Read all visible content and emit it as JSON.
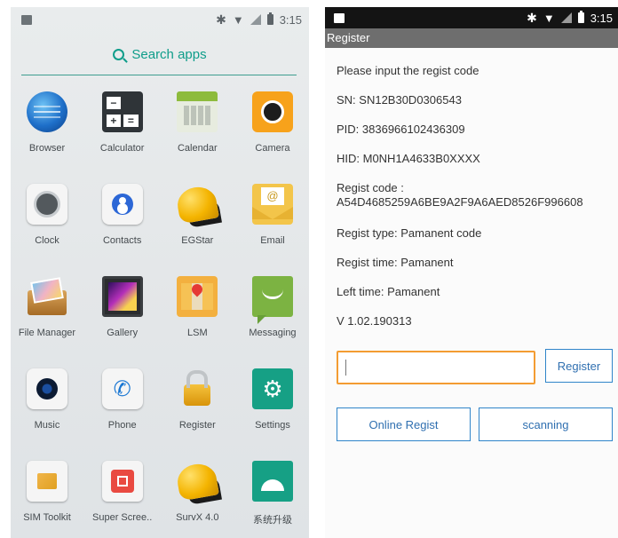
{
  "launcher": {
    "status_time": "3:15",
    "search_label": "Search apps",
    "apps": [
      {
        "label": "Browser",
        "icon": "globe-icon"
      },
      {
        "label": "Calculator",
        "icon": "calculator-icon"
      },
      {
        "label": "Calendar",
        "icon": "calendar-icon"
      },
      {
        "label": "Camera",
        "icon": "camera-icon"
      },
      {
        "label": "Clock",
        "icon": "clock-icon"
      },
      {
        "label": "Contacts",
        "icon": "contacts-icon"
      },
      {
        "label": "EGStar",
        "icon": "helmet-icon"
      },
      {
        "label": "Email",
        "icon": "envelope-icon"
      },
      {
        "label": "File Manager",
        "icon": "folder-icon"
      },
      {
        "label": "Gallery",
        "icon": "gallery-icon"
      },
      {
        "label": "LSM",
        "icon": "map-pin-icon"
      },
      {
        "label": "Messaging",
        "icon": "message-icon"
      },
      {
        "label": "Music",
        "icon": "music-icon"
      },
      {
        "label": "Phone",
        "icon": "phone-icon"
      },
      {
        "label": "Register",
        "icon": "lock-key-icon"
      },
      {
        "label": "Settings",
        "icon": "gear-icon"
      },
      {
        "label": "SIM Toolkit",
        "icon": "sim-icon"
      },
      {
        "label": "Super Scree..",
        "icon": "screen-record-icon"
      },
      {
        "label": "SurvX 4.0",
        "icon": "helmet-icon"
      },
      {
        "label": "系统升级",
        "icon": "android-update-icon"
      }
    ]
  },
  "register": {
    "status_time": "3:15",
    "title": "Register",
    "prompt": "Please input the regist code",
    "sn": "SN: SN12B30D0306543",
    "pid": "PID: 3836966102436309",
    "hid": "HID: M0NH1A4633B0XXXX",
    "regist_code_label": "Regist code :",
    "regist_code_value": "A54D4685259A6BE9A2F9A6AED8526F996608",
    "regist_type": "Regist type:   Pamanent code",
    "regist_time": "Regist time:   Pamanent",
    "left_time": "Left time:   Pamanent",
    "version": "V 1.02.190313",
    "code_input_value": "",
    "register_button": "Register",
    "online_regist_button": "Online Regist",
    "scanning_button": "scanning"
  },
  "colors": {
    "accent_teal": "#0f9d8a",
    "input_border_orange": "#f39c32",
    "button_blue": "#2f84c9",
    "titlebar_gray": "#6e6e6e"
  }
}
